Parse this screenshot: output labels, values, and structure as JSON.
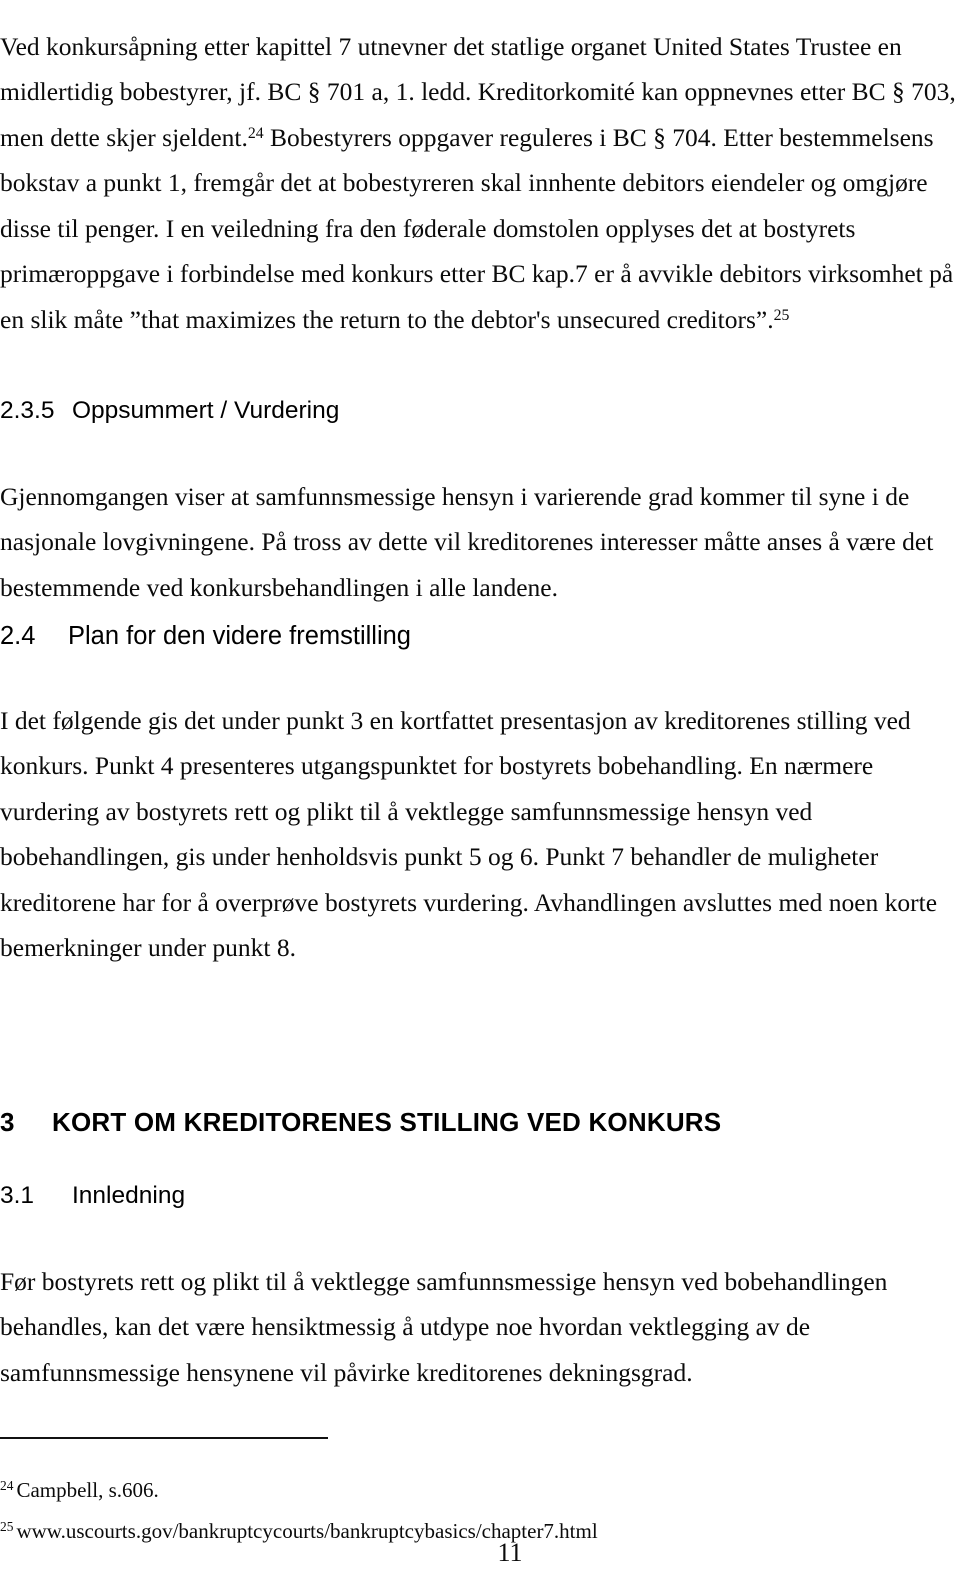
{
  "document": {
    "language": "Norwegian",
    "page_number": "11"
  },
  "body": {
    "para_1_part_1": "Ved konkursåpning etter kapittel 7 utnevner det statlige organet United States Trustee en midlertidig bobestyrer, jf. BC § 701 a, 1. ledd. Kreditorkomité kan oppnevnes etter BC § 703, men dette skjer sjeldent.",
    "para_1_ref_a": "24",
    "para_1_part_2": " Bobestyrers oppgaver reguleres i BC § 704. Etter bestemmelsens bokstav a punkt 1, fremgår det at bobestyreren skal innhente debitors eiendeler og omgjøre disse til penger. I en veiledning fra den føderale domstolen opplyses det at bostyrets primæroppgave i forbindelse med konkurs etter BC kap.7 er å avvikle debitors virksomhet på en slik måte ”that maximizes the return to the debtor's unsecured creditors”.",
    "para_1_ref_b": "25",
    "para_1_part_3": "",
    "para_2": "Gjennomgangen viser at samfunnsmessige hensyn i varierende grad kommer til syne i de nasjonale lovgivningene. På tross av dette vil kreditorenes interesser måtte anses å være det bestemmende ved konkursbehandlingen i alle landene.",
    "para_3": "I det følgende gis det under punkt 3 en kortfattet presentasjon av kreditorenes stilling ved konkurs. Punkt 4 presenteres utgangspunktet for bostyrets bobehandling. En nærmere vurdering av bostyrets rett og plikt til å vektlegge samfunnsmessige hensyn ved bobehandlingen, gis under henholdsvis punkt 5 og 6. Punkt 7 behandler de muligheter kreditorene har for å overprøve bostyrets vurdering. Avhandlingen avsluttes med noen korte bemerkninger under punkt 8.",
    "para_4": "Før bostyrets rett og plikt til å vektlegge samfunnsmessige hensyn ved bobehandlingen behandles, kan det være hensiktmessig å utdype noe hvordan vektlegging av de samfunnsmessige hensynene vil påvirke kreditorenes dekningsgrad."
  },
  "headings": {
    "h235": {
      "number": "2.3.5",
      "title": "Oppsummert / Vurdering"
    },
    "h24": {
      "number": "2.4",
      "title": "Plan for den videre fremstilling"
    },
    "h3": {
      "number": "3",
      "title": "KORT OM KREDITORENES STILLING VED KONKURS"
    },
    "h31": {
      "number": "3.1",
      "title": "Innledning"
    }
  },
  "footnotes": [
    {
      "marker": "24",
      "text": "Campbell, s.606."
    },
    {
      "marker": "25",
      "text": "www.uscourts.gov/bankruptcycourts/bankruptcybasics/chapter7.html"
    }
  ]
}
